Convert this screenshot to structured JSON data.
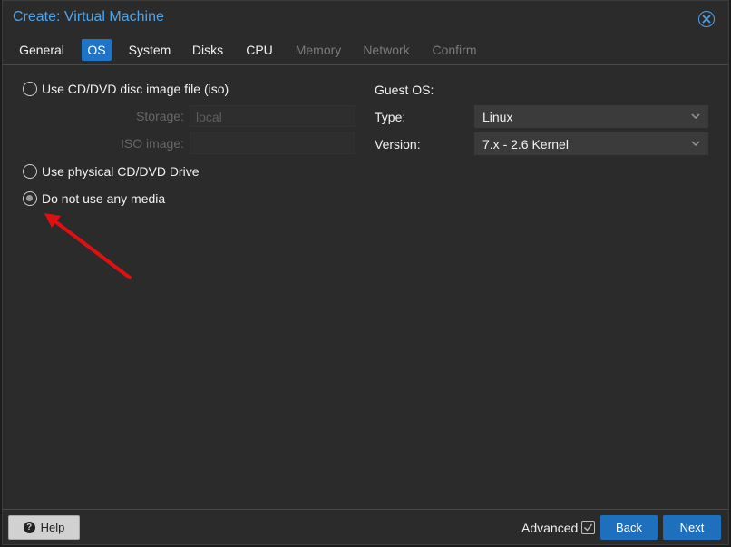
{
  "window": {
    "title": "Create: Virtual Machine"
  },
  "tabs": [
    {
      "label": "General"
    },
    {
      "label": "OS"
    },
    {
      "label": "System"
    },
    {
      "label": "Disks"
    },
    {
      "label": "CPU"
    },
    {
      "label": "Memory"
    },
    {
      "label": "Network"
    },
    {
      "label": "Confirm"
    }
  ],
  "media": {
    "option_iso": "Use CD/DVD disc image file (iso)",
    "storage_label": "Storage:",
    "storage_value": "local",
    "iso_label": "ISO image:",
    "iso_value": "",
    "option_physical": "Use physical CD/DVD Drive",
    "option_none": "Do not use any media",
    "selected": "none"
  },
  "guest_os": {
    "heading": "Guest OS:",
    "type_label": "Type:",
    "type_value": "Linux",
    "version_label": "Version:",
    "version_value": "7.x - 2.6 Kernel"
  },
  "footer": {
    "help_label": "Help",
    "advanced_label": "Advanced",
    "advanced_checked": true,
    "back_label": "Back",
    "next_label": "Next"
  },
  "colors": {
    "accent": "#1f74c8",
    "title": "#4fa3e8",
    "annotation_arrow": "#e01010"
  },
  "icons": {
    "close": "close-circle-icon",
    "help": "question-circle-icon",
    "dropdown": "chevron-down-icon",
    "check": "checkmark-icon"
  }
}
